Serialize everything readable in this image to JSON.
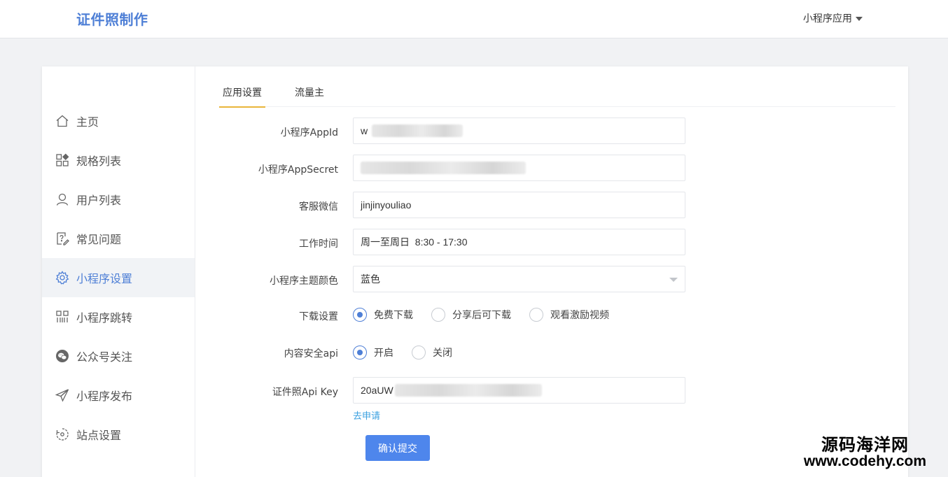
{
  "header": {
    "brand": "证件照制作",
    "menu_label": "小程序应用"
  },
  "sidebar": {
    "items": [
      {
        "label": "主页",
        "icon": "home-icon"
      },
      {
        "label": "规格列表",
        "icon": "grid-icon"
      },
      {
        "label": "用户列表",
        "icon": "user-icon"
      },
      {
        "label": "常见问题",
        "icon": "question-doc-icon"
      },
      {
        "label": "小程序设置",
        "icon": "gear-icon",
        "active": true
      },
      {
        "label": "小程序跳转",
        "icon": "apps-icon"
      },
      {
        "label": "公众号关注",
        "icon": "wechat-icon"
      },
      {
        "label": "小程序发布",
        "icon": "paper-plane-icon"
      },
      {
        "label": "站点设置",
        "icon": "site-settings-icon"
      }
    ]
  },
  "tabs": [
    {
      "label": "应用设置",
      "active": true
    },
    {
      "label": "流量主",
      "active": false
    }
  ],
  "form": {
    "appid": {
      "label": "小程序AppId",
      "value": "w"
    },
    "appsecret": {
      "label": "小程序AppSecret",
      "value": ""
    },
    "service_wechat": {
      "label": "客服微信",
      "value": "jinjinyouliao"
    },
    "work_time": {
      "label": "工作时间",
      "value": "周一至周日  8:30 - 17:30"
    },
    "theme_color": {
      "label": "小程序主题颜色",
      "value": "蓝色"
    },
    "download": {
      "label": "下载设置",
      "options": [
        "免费下载",
        "分享后可下载",
        "观看激励视频"
      ],
      "selected": "免费下载"
    },
    "content_security": {
      "label": "内容安全api",
      "options": [
        "开启",
        "关闭"
      ],
      "selected": "开启"
    },
    "api_key": {
      "label": "证件照Api Key",
      "value": "20aUW"
    },
    "apply_link": "去申请",
    "submit_label": "确认提交"
  },
  "watermark": {
    "line1": "源码海洋网",
    "line2": "www.codehy.com"
  },
  "colors": {
    "accent": "#4e7fd6",
    "tab_underline": "#e9b53a",
    "button": "#4e86ec",
    "link": "#3aa0e0"
  }
}
